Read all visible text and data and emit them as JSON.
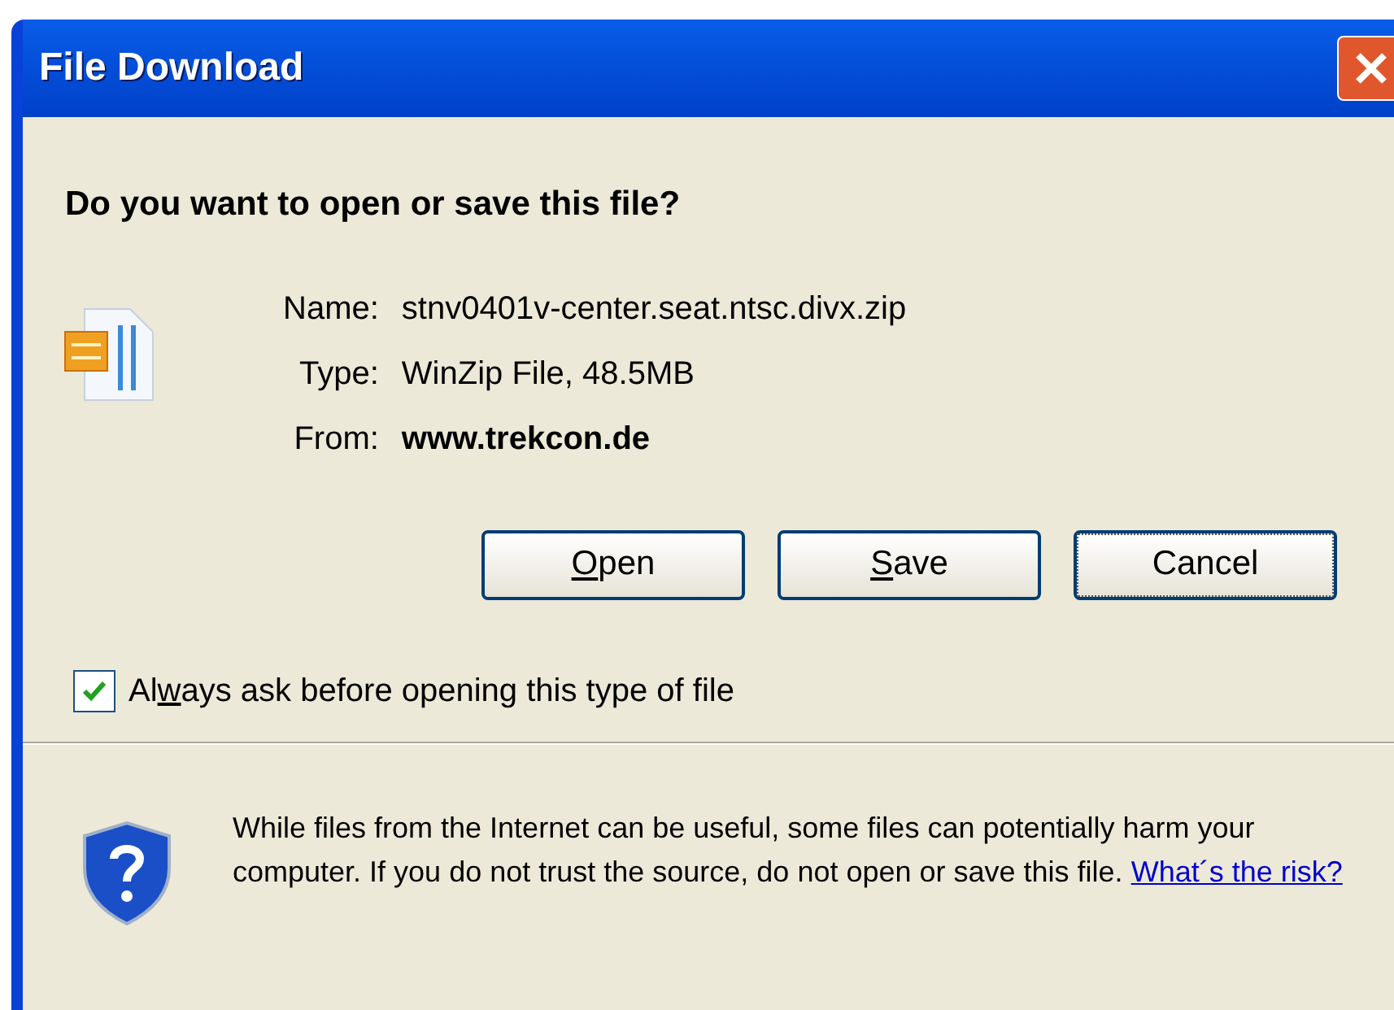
{
  "window": {
    "title": "File Download"
  },
  "heading": "Do you want to open or save this file?",
  "fields": [
    {
      "label": "Name:",
      "value": "stnv0401v-center.seat.ntsc.divx.zip",
      "bold": false
    },
    {
      "label": "Type:",
      "value": "WinZip File, 48.5MB",
      "bold": false
    },
    {
      "label": "From:",
      "value": "www.trekcon.de",
      "bold": true
    }
  ],
  "buttons": [
    {
      "key": "O",
      "rest": "pen",
      "focused": false
    },
    {
      "key": "S",
      "rest": "ave",
      "focused": false
    },
    {
      "rest": "Cancel",
      "focused": true
    }
  ],
  "checkbox": {
    "before": "Al",
    "key": "w",
    "after": "ays ask before opening this type of file",
    "checked": true
  },
  "warning": {
    "text": "While files from the Internet can be useful, some files can potentially harm your computer. If you do not trust the source, do not open or save this file.",
    "link": "What´s the risk?"
  }
}
